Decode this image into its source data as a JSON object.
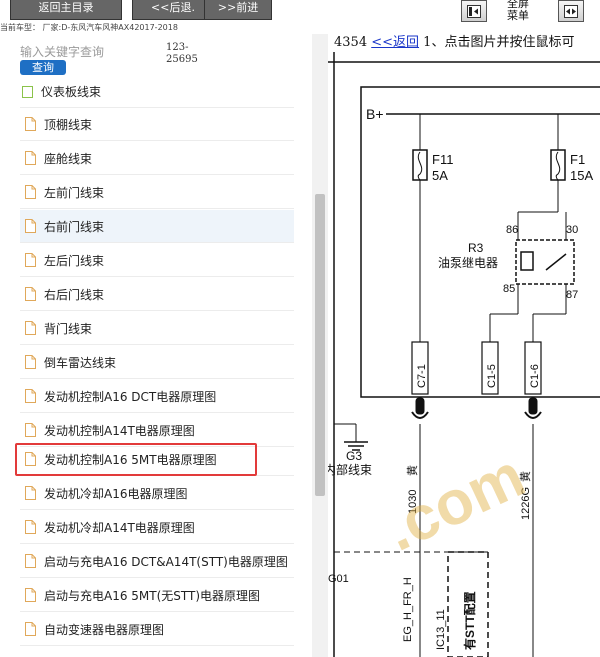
{
  "toolbar": {
    "home_label": "返回主目录",
    "back_label": "<<后退.",
    "forward_label": ">>前进",
    "fullscreen_menu_label": "全屏\n菜单"
  },
  "vehicle": {
    "line": "当前车型：  厂家:D-东风汽车风神AX42017-2018"
  },
  "search": {
    "placeholder": "输入关键字查询",
    "button_label": "查询",
    "result_count": "123-25695"
  },
  "tree": {
    "items": [
      {
        "label": "仪表板线束"
      },
      {
        "label": "顶棚线束"
      },
      {
        "label": "座舱线束"
      },
      {
        "label": "左前门线束"
      },
      {
        "label": "右前门线束"
      },
      {
        "label": "左后门线束"
      },
      {
        "label": "右后门线束"
      },
      {
        "label": "背门线束"
      },
      {
        "label": "倒车雷达线束"
      },
      {
        "label": "发动机控制A16 DCT电器原理图"
      },
      {
        "label": "发动机控制A14T电器原理图"
      },
      {
        "label": "发动机控制A16 5MT电器原理图"
      },
      {
        "label": "发动机冷却A16电器原理图"
      },
      {
        "label": "发动机冷却A14T电器原理图"
      },
      {
        "label": "启动与充电A16 DCT&A14T(STT)电器原理图"
      },
      {
        "label": "启动与充电A16 5MT(无STT)电器原理图"
      },
      {
        "label": "自动变速器电器原理图"
      }
    ],
    "selected_index": 11,
    "hover_index": 4
  },
  "document": {
    "page_number": "4354",
    "back_link": "<<返回",
    "instruction": "1、点击图片并按住鼠标可"
  },
  "diagram": {
    "supply_label": "B+",
    "fuse1_name": "F11",
    "fuse1_rating": "5A",
    "fuse2_name": "F1",
    "fuse2_rating": "15A",
    "relay_name": "R3",
    "relay_desc": "油泵继电器",
    "pin_86": "86",
    "pin_30": "30",
    "pin_85": "85",
    "pin_87": "87",
    "conn_c7": "C7-1",
    "conn_c1a": "C1-5",
    "conn_c1b": "C1-6",
    "ground_name": "G3",
    "ground_desc": "内部线束",
    "wire_1030": "1030",
    "wire_1030_color": "黄",
    "wire_1226": "1226G",
    "wire_1226_color": "黄",
    "label_g01": "G01",
    "label_eg": "EG_H_FR_H",
    "label_ic": "IC13_11",
    "label_stt": "有STT配置",
    "watermark": ".com"
  },
  "colors": {
    "toolbar_button": "#666666",
    "search_button": "#1e6fc4",
    "selection_border": "#e23a3a",
    "link": "#1a36c9",
    "watermark": "#e0b040"
  }
}
